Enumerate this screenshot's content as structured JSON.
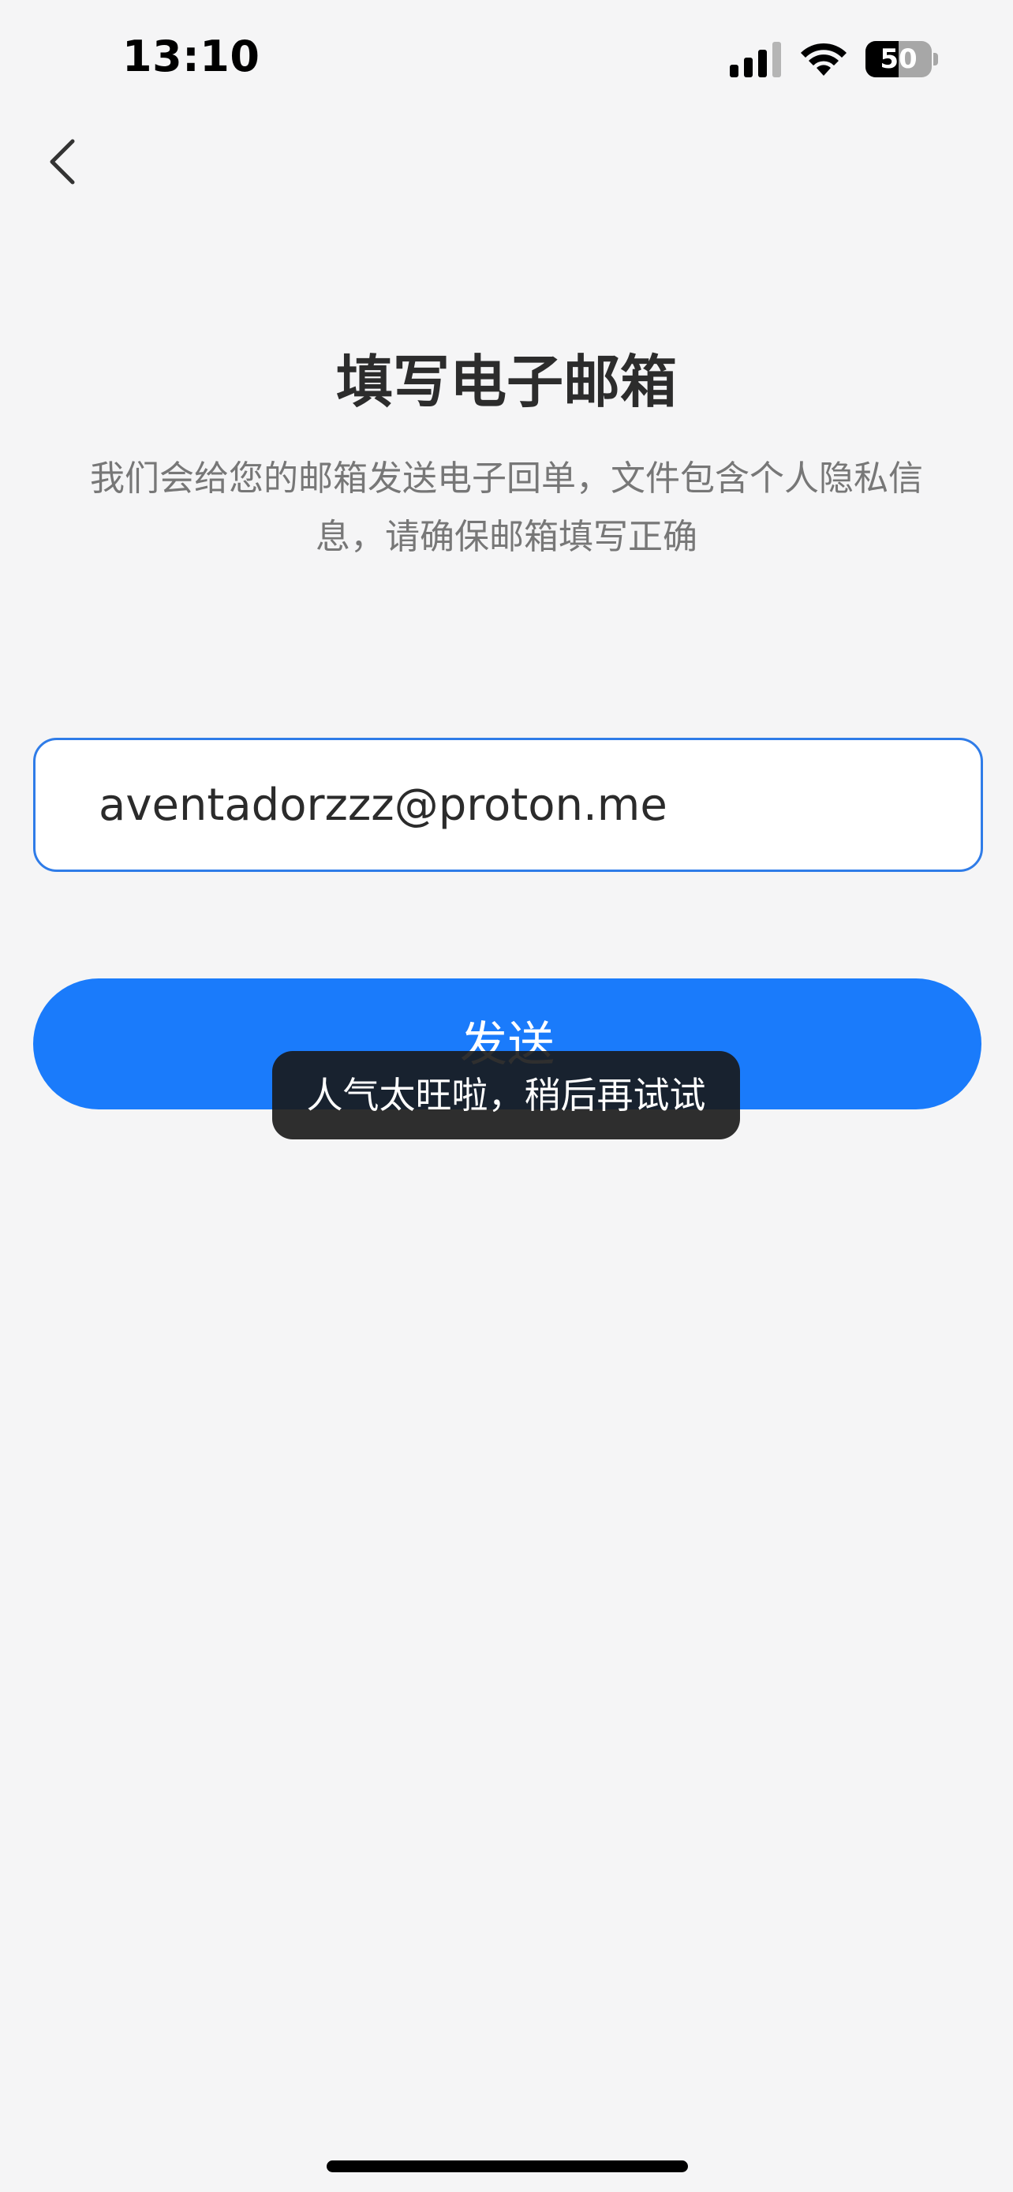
{
  "status_bar": {
    "time": "13:10",
    "battery_level": "50",
    "battery_fraction": 0.5,
    "signal_icon": "cellular-signal-icon",
    "wifi_icon": "wifi-icon"
  },
  "nav": {
    "back_icon": "chevron-left-icon"
  },
  "header": {
    "title": "填写电子邮箱",
    "description": "我们会给您的邮箱发送电子回单，文件包含个人隐私信息，请确保邮箱填写正确"
  },
  "form": {
    "email_value": "aventadorzzz@proton.me",
    "send_label": "发送"
  },
  "toast": {
    "message": "人气太旺啦，稍后再试试"
  },
  "colors": {
    "accent": "#1a7bfb",
    "input_border": "#2f7ce8",
    "background": "#f5f5f6",
    "toast_bg": "#181818"
  }
}
